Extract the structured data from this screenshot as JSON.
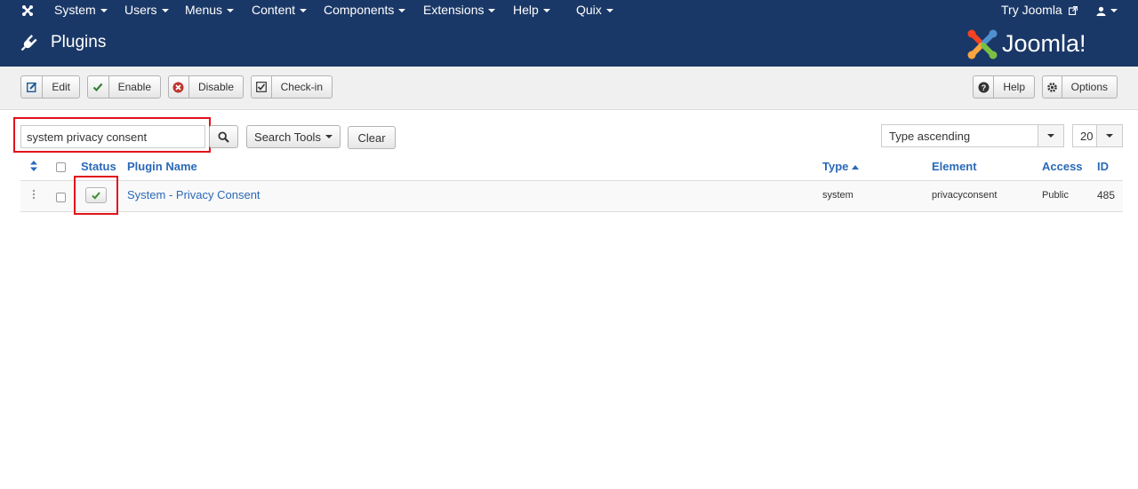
{
  "topnav": {
    "menus": [
      {
        "label": "System"
      },
      {
        "label": "Users"
      },
      {
        "label": "Menus"
      },
      {
        "label": "Content"
      },
      {
        "label": "Components"
      },
      {
        "label": "Extensions"
      },
      {
        "label": "Help"
      },
      {
        "label": "Quix"
      }
    ],
    "try_joomla": "Try Joomla"
  },
  "header": {
    "title": "Plugins",
    "logo_text": "Joomla!"
  },
  "toolbar": {
    "edit": "Edit",
    "enable": "Enable",
    "disable": "Disable",
    "checkin": "Check-in",
    "help": "Help",
    "options": "Options"
  },
  "filters": {
    "search_value": "system privacy consent",
    "search_tools": "Search Tools",
    "clear": "Clear",
    "ordering": "Type ascending",
    "limit": "20"
  },
  "table": {
    "headers": {
      "status": "Status",
      "name": "Plugin Name",
      "type": "Type",
      "element": "Element",
      "access": "Access",
      "id": "ID"
    },
    "rows": [
      {
        "name": "System - Privacy Consent",
        "type": "system",
        "element": "privacyconsent",
        "access": "Public",
        "id": "485",
        "status": "enabled"
      }
    ]
  },
  "colors": {
    "navbar": "#1a3867",
    "link": "#2a69b8",
    "highlight": "#e1131a",
    "enabled": "#3c8b2e"
  }
}
